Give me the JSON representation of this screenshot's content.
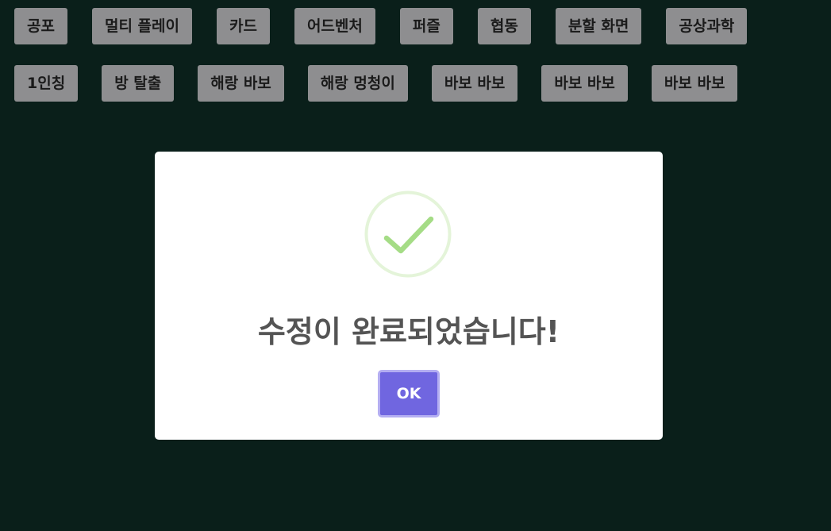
{
  "tags_row1": [
    "공포",
    "멀티 플레이",
    "카드",
    "어드벤처",
    "퍼즐",
    "협동",
    "분할 화면",
    "공상과학"
  ],
  "tags_row2": [
    "1인칭",
    "방 탈출",
    "해랑 바보",
    "해랑 멍청이",
    "바보 바보",
    "바보 바보",
    "바보 바보"
  ],
  "modal": {
    "icon": "success-check-icon",
    "title": "수정이 완료되었습니다!",
    "ok_label": "OK"
  },
  "colors": {
    "background": "#0a1f1a",
    "tag_bg": "#8e8e90",
    "success": "#a5dc86",
    "confirm_button": "#7066e0"
  }
}
